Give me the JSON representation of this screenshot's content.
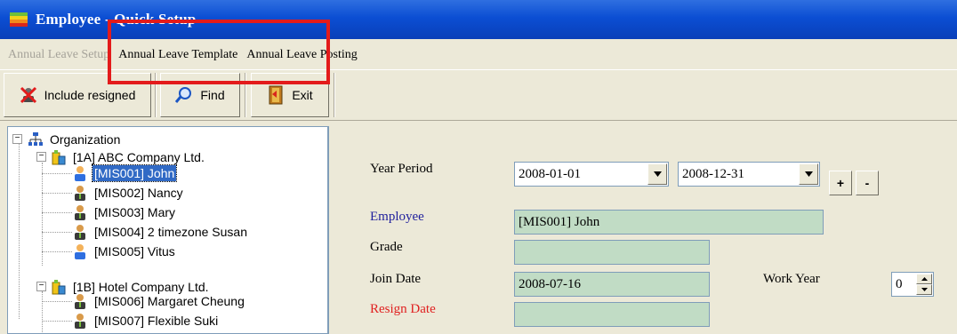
{
  "window": {
    "title": "Employee - Quick Setup"
  },
  "menu": {
    "items": [
      {
        "label": "Annual Leave Setup",
        "enabled": false
      },
      {
        "label": "Annual Leave Template",
        "enabled": true
      },
      {
        "label": "Annual Leave Posting",
        "enabled": true
      }
    ]
  },
  "toolbar": {
    "include_resigned_label": "Include resigned",
    "find_label": "Find",
    "exit_label": "Exit"
  },
  "tree": {
    "root": "Organization",
    "companies": [
      {
        "label": "[1A] ABC Company Ltd.",
        "employees": [
          {
            "label": "[MIS001] John",
            "selected": true
          },
          {
            "label": "[MIS002] Nancy"
          },
          {
            "label": "[MIS003] Mary"
          },
          {
            "label": "[MIS004] 2 timezone Susan"
          },
          {
            "label": "[MIS005] Vitus"
          }
        ]
      },
      {
        "label": "[1B] Hotel Company Ltd.",
        "employees": [
          {
            "label": "[MIS006] Margaret Cheung"
          },
          {
            "label": "[MIS007] Flexible Suki"
          }
        ]
      }
    ]
  },
  "form": {
    "year_period_label": "Year Period",
    "year_start": "2008-01-01",
    "year_end": "2008-12-31",
    "plus_label": "+",
    "minus_label": "-",
    "employee_label": "Employee",
    "employee_value": "[MIS001] John",
    "grade_label": "Grade",
    "grade_value": "",
    "join_date_label": "Join Date",
    "join_date_value": "2008-07-16",
    "work_year_label": "Work Year",
    "work_year_value": "0",
    "resign_date_label": "Resign Date",
    "resign_date_value": ""
  },
  "colors": {
    "title_bar": "#0b4ed3",
    "highlight": "#e31b1b",
    "selected_bg": "#316ac5",
    "field_green": "#c1dcc5",
    "employee_label": "#1f1f9c",
    "resign_label": "#e02020"
  }
}
